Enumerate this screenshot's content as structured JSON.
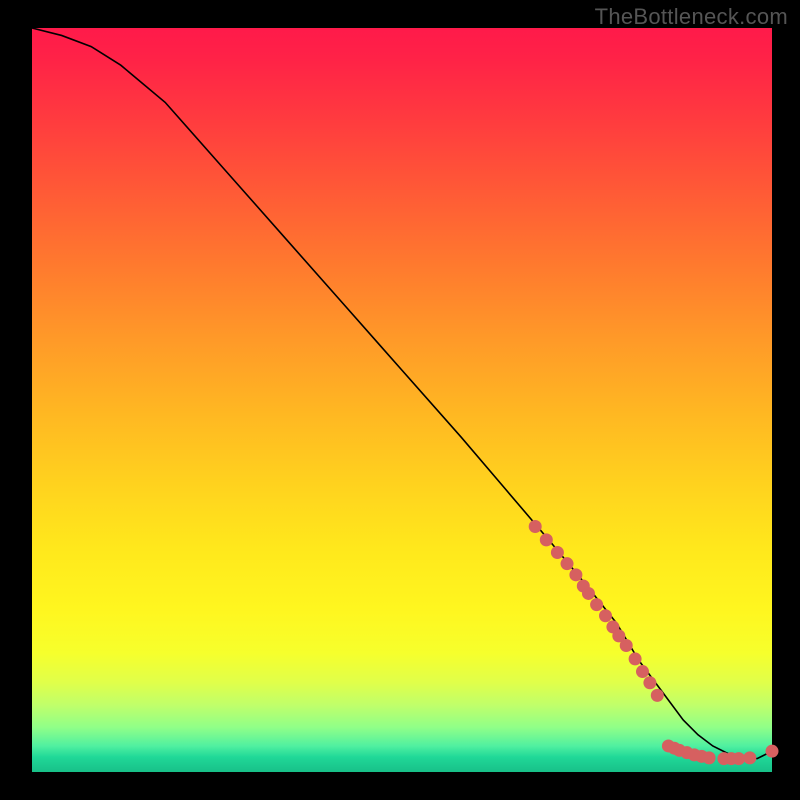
{
  "watermark": "TheBottleneck.com",
  "chart_data": {
    "type": "line",
    "title": "",
    "xlabel": "",
    "ylabel": "",
    "xlim": [
      0,
      100
    ],
    "ylim": [
      0,
      100
    ],
    "grid": false,
    "series": [
      {
        "name": "curve",
        "x": [
          0,
          4,
          8,
          12,
          18,
          26,
          34,
          42,
          50,
          58,
          64,
          70,
          75,
          79,
          82,
          85,
          88,
          90,
          92,
          94,
          96,
          98,
          100
        ],
        "values": [
          100,
          99,
          97.5,
          95,
          90,
          81,
          72,
          63,
          54,
          45,
          38,
          31,
          25,
          20,
          15,
          11,
          7,
          5,
          3.5,
          2.5,
          2,
          1.8,
          2.8
        ]
      }
    ],
    "markers": [
      {
        "x": 68,
        "y": 33
      },
      {
        "x": 69.5,
        "y": 31.2
      },
      {
        "x": 71,
        "y": 29.5
      },
      {
        "x": 72.3,
        "y": 28
      },
      {
        "x": 73.5,
        "y": 26.5
      },
      {
        "x": 74.5,
        "y": 25
      },
      {
        "x": 75.2,
        "y": 24
      },
      {
        "x": 76.3,
        "y": 22.5
      },
      {
        "x": 77.5,
        "y": 21
      },
      {
        "x": 78.5,
        "y": 19.5
      },
      {
        "x": 79.3,
        "y": 18.3
      },
      {
        "x": 80.3,
        "y": 17
      },
      {
        "x": 81.5,
        "y": 15.2
      },
      {
        "x": 82.5,
        "y": 13.5
      },
      {
        "x": 83.5,
        "y": 12
      },
      {
        "x": 84.5,
        "y": 10.3
      },
      {
        "x": 86,
        "y": 3.5
      },
      {
        "x": 86.8,
        "y": 3.2
      },
      {
        "x": 87.5,
        "y": 2.9
      },
      {
        "x": 88.5,
        "y": 2.6
      },
      {
        "x": 89.5,
        "y": 2.3
      },
      {
        "x": 90.5,
        "y": 2.1
      },
      {
        "x": 91.5,
        "y": 1.9
      },
      {
        "x": 93.5,
        "y": 1.8
      },
      {
        "x": 94.5,
        "y": 1.8
      },
      {
        "x": 95.5,
        "y": 1.8
      },
      {
        "x": 97,
        "y": 1.9
      },
      {
        "x": 100,
        "y": 2.8
      }
    ],
    "marker_color": "#d66060",
    "line_color": "#000000"
  }
}
